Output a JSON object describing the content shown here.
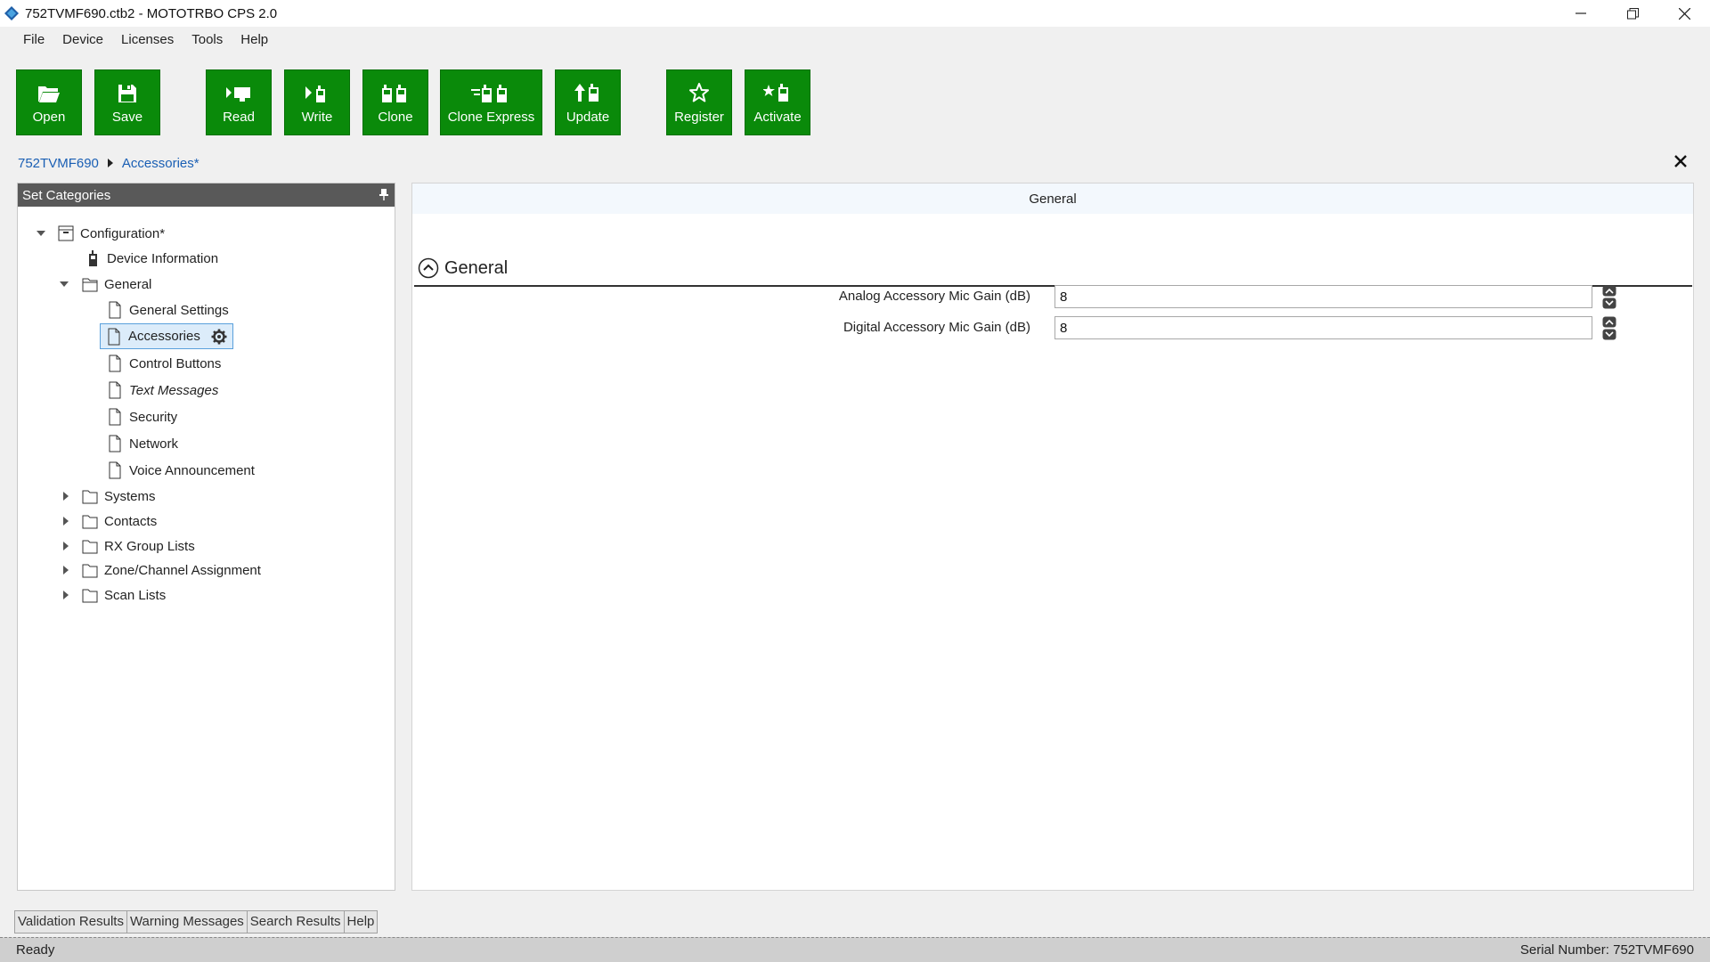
{
  "window": {
    "title": "752TVMF690.ctb2 - MOTOTRBO CPS 2.0",
    "controls": [
      "minimize-icon",
      "restore-icon",
      "close-icon"
    ]
  },
  "menu": [
    {
      "label": "File"
    },
    {
      "label": "Device"
    },
    {
      "label": "Licenses"
    },
    {
      "label": "Tools"
    },
    {
      "label": "Help"
    }
  ],
  "toolbar": {
    "open": "Open",
    "save": "Save",
    "read": "Read",
    "write": "Write",
    "clone": "Clone",
    "clone_express": "Clone Express",
    "update": "Update",
    "register": "Register",
    "activate": "Activate",
    "accent_color": "#0a8a0a"
  },
  "breadcrumb": {
    "root": "752TVMF690",
    "current": "Accessories*"
  },
  "left_panel": {
    "title": "Set Categories",
    "tree": {
      "configuration": "Configuration*",
      "device_information": "Device Information",
      "general": "General",
      "general_settings": "General Settings",
      "accessories": "Accessories",
      "control_buttons": "Control Buttons",
      "text_messages": "Text Messages",
      "security": "Security",
      "network": "Network",
      "voice_announcement": "Voice Announcement",
      "systems": "Systems",
      "contacts": "Contacts",
      "rx_group_lists": "RX Group Lists",
      "zone_channel_assignment": "Zone/Channel Assignment",
      "scan_lists": "Scan Lists"
    }
  },
  "main": {
    "tab": "General",
    "section_title": "General",
    "fields": [
      {
        "label": "Analog Accessory Mic Gain (dB)",
        "value": "8"
      },
      {
        "label": "Digital Accessory Mic Gain (dB)",
        "value": "8"
      }
    ]
  },
  "bottom_tabs": [
    {
      "label": "Validation Results"
    },
    {
      "label": "Warning Messages"
    },
    {
      "label": "Search Results"
    },
    {
      "label": "Help"
    }
  ],
  "status": {
    "left": "Ready",
    "right": "Serial Number: 752TVMF690"
  }
}
